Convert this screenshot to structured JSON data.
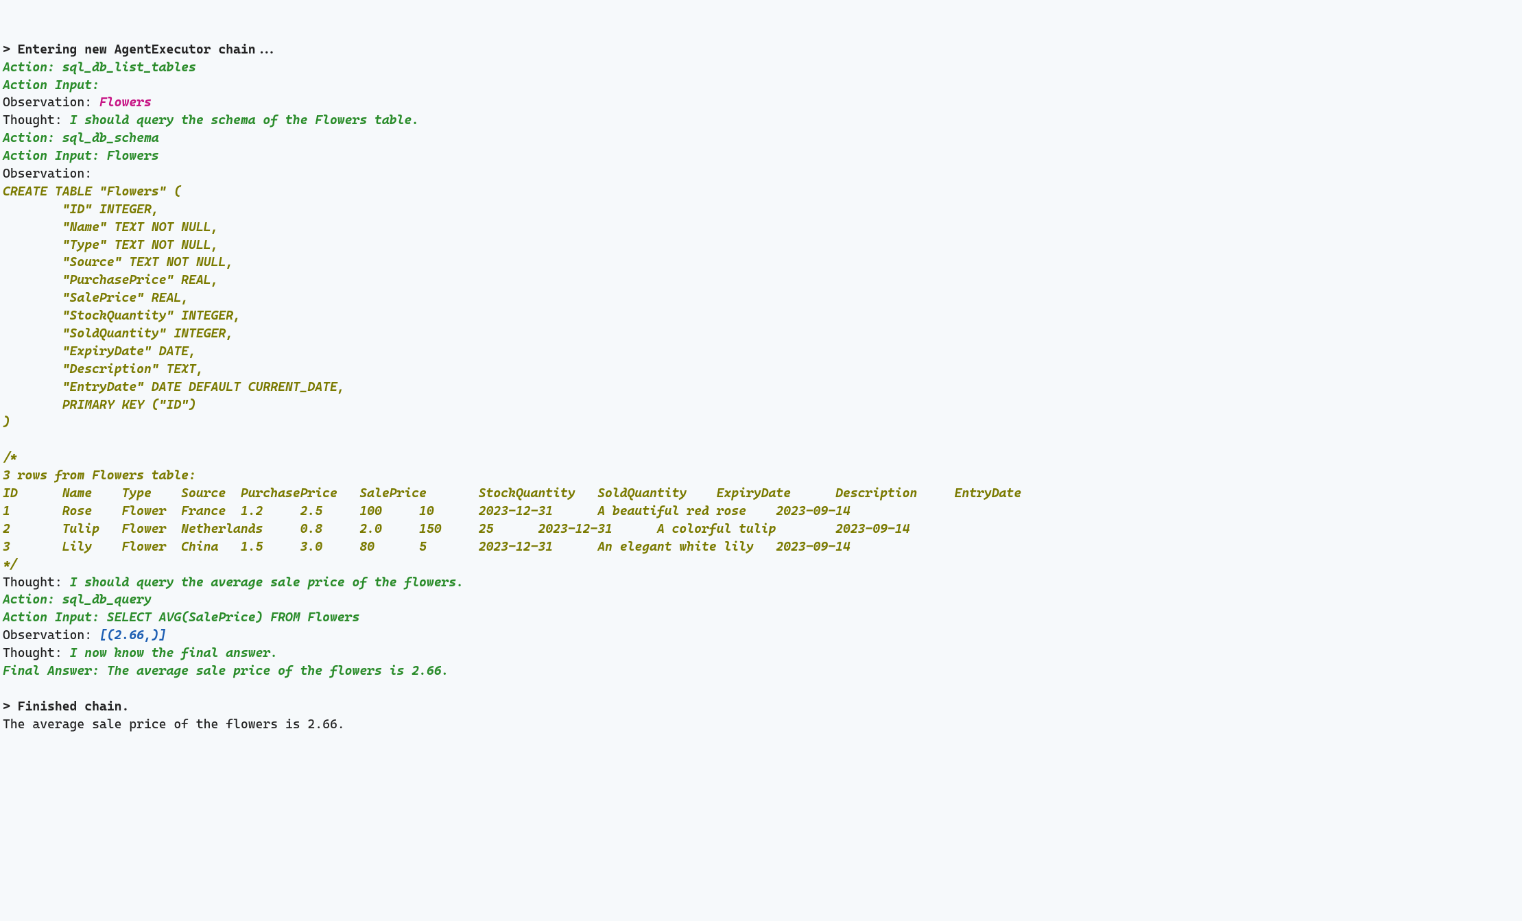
{
  "line1_bold": "> Entering new AgentExecutor chain...",
  "line2_green": "Action: sql_db_list_tables",
  "line3_green": "Action Input:",
  "line4_plain": "Observation: ",
  "line4_magenta": "Flowers",
  "line5_plain": "Thought: ",
  "line5_green": "I should query the schema of the Flowers table.",
  "line6_green": "Action: sql_db_schema",
  "line7_green": "Action Input: Flowers",
  "line8_plain": "Observation:",
  "schema_line1": "CREATE TABLE \"Flowers\" (",
  "schema_line2": "        \"ID\" INTEGER,",
  "schema_line3": "        \"Name\" TEXT NOT NULL,",
  "schema_line4": "        \"Type\" TEXT NOT NULL,",
  "schema_line5": "        \"Source\" TEXT NOT NULL,",
  "schema_line6": "        \"PurchasePrice\" REAL,",
  "schema_line7": "        \"SalePrice\" REAL,",
  "schema_line8": "        \"StockQuantity\" INTEGER,",
  "schema_line9": "        \"SoldQuantity\" INTEGER,",
  "schema_line10": "        \"ExpiryDate\" DATE,",
  "schema_line11": "        \"Description\" TEXT,",
  "schema_line12": "        \"EntryDate\" DATE DEFAULT CURRENT_DATE,",
  "schema_line13": "        PRIMARY KEY (\"ID\")",
  "schema_line14": ")",
  "blank": "",
  "comment_open": "/*",
  "rows_header": "3 rows from Flowers table:",
  "cols_line": "ID      Name    Type    Source  PurchasePrice   SalePrice       StockQuantity   SoldQuantity    ExpiryDate      Description     EntryDate",
  "row1": "1       Rose    Flower  France  1.2     2.5     100     10      2023-12-31      A beautiful red rose    2023-09-14",
  "row2": "2       Tulip   Flower  Netherlands     0.8     2.0     150     25      2023-12-31      A colorful tulip        2023-09-14",
  "row3": "3       Lily    Flower  China   1.5     3.0     80      5       2023-12-31      An elegant white lily   2023-09-14",
  "comment_close": "*/",
  "thought2_plain": "Thought: ",
  "thought2_green": "I should query the average sale price of the flowers.",
  "action3_green": "Action: sql_db_query",
  "input3_green": "Action Input: SELECT AVG(SalePrice) FROM Flowers",
  "obs3_plain": "Observation: ",
  "obs3_blue": "[(2.66,)]",
  "thought3_plain": "Thought: ",
  "thought3_green": "I now know the final answer.",
  "final_green": "Final Answer: The average sale price of the flowers is 2.66.",
  "finished_bold": "> Finished chain.",
  "result_plain": "The average sale price of the flowers is 2.66."
}
